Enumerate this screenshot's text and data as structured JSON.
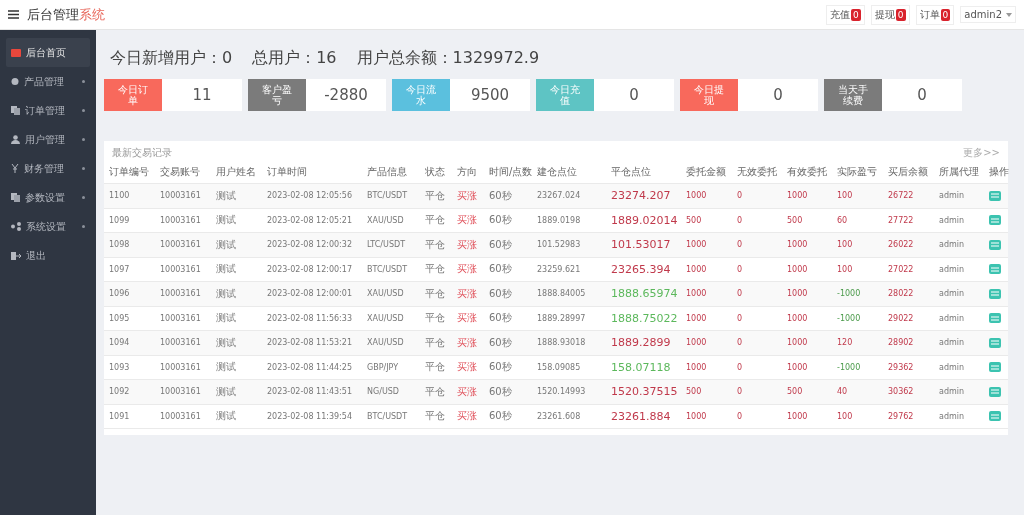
{
  "header": {
    "title": "后台管理",
    "title_suffix": "系统",
    "badges": [
      {
        "label": "充值",
        "count": "0"
      },
      {
        "label": "提现",
        "count": "0"
      },
      {
        "label": "订单",
        "count": "0"
      }
    ],
    "user": "admin2"
  },
  "sidebar": {
    "items": [
      {
        "label": "后台首页",
        "selected": true,
        "has_children": false,
        "kind": "home"
      },
      {
        "label": "产品管理",
        "selected": false,
        "has_children": true,
        "kind": "money"
      },
      {
        "label": "订单管理",
        "selected": false,
        "has_children": true,
        "kind": "copy"
      },
      {
        "label": "用户管理",
        "selected": false,
        "has_children": true,
        "kind": "user"
      },
      {
        "label": "财务管理",
        "selected": false,
        "has_children": true,
        "kind": "yen"
      },
      {
        "label": "参数设置",
        "selected": false,
        "has_children": true,
        "kind": "copy"
      },
      {
        "label": "系统设置",
        "selected": false,
        "has_children": true,
        "kind": "share"
      },
      {
        "label": "退出",
        "selected": false,
        "has_children": false,
        "kind": "exit"
      }
    ]
  },
  "summary": [
    {
      "label": "今日新增用户：",
      "value": "0"
    },
    {
      "label": "总用户：",
      "value": "16"
    },
    {
      "label": "用户总余额：",
      "value": "1329972.9"
    }
  ],
  "stats": [
    {
      "label": "今日订单",
      "value": "11",
      "color": "#f8695c"
    },
    {
      "label": "客户盈亏",
      "value": "-2880",
      "color": "#7b7b7b"
    },
    {
      "label": "今日流水",
      "value": "9500",
      "color": "#5bc0de"
    },
    {
      "label": "今日充值",
      "value": "0",
      "color": "#5ec4c4"
    },
    {
      "label": "今日提现",
      "value": "0",
      "color": "#f8695c"
    },
    {
      "label": "当天手续费",
      "value": "0",
      "color": "#7b7b7b"
    }
  ],
  "table": {
    "title": "最新交易记录",
    "more": "更多>>",
    "columns": [
      "订单编号",
      "交易账号",
      "用户姓名",
      "订单时间",
      "产品信息",
      "状态",
      "方向",
      "时间/点数",
      "建仓点位",
      "平仓点位",
      "委托金额",
      "无效委托",
      "有效委托",
      "实际盈亏",
      "买后余额",
      "所属代理",
      "操作"
    ],
    "rows": [
      {
        "cells": [
          "1100",
          "10003161",
          "测试",
          "2023-02-08 12:05:56",
          "BTC/USDT",
          "平仓",
          "买涨",
          "60秒",
          "23267.024",
          "23274.207",
          "1000",
          "0",
          "1000",
          "100",
          "26722",
          "admin"
        ],
        "loss": false
      },
      {
        "cells": [
          "1099",
          "10003161",
          "测试",
          "2023-02-08 12:05:21",
          "XAU/USD",
          "平仓",
          "买涨",
          "60秒",
          "1889.0198",
          "1889.02014",
          "500",
          "0",
          "500",
          "60",
          "27722",
          "admin"
        ],
        "loss": false
      },
      {
        "cells": [
          "1098",
          "10003161",
          "测试",
          "2023-02-08 12:00:32",
          "LTC/USDT",
          "平仓",
          "买涨",
          "60秒",
          "101.52983",
          "101.53017",
          "1000",
          "0",
          "1000",
          "100",
          "26022",
          "admin"
        ],
        "loss": false
      },
      {
        "cells": [
          "1097",
          "10003161",
          "测试",
          "2023-02-08 12:00:17",
          "BTC/USDT",
          "平仓",
          "买涨",
          "60秒",
          "23259.621",
          "23265.394",
          "1000",
          "0",
          "1000",
          "100",
          "27022",
          "admin"
        ],
        "loss": false
      },
      {
        "cells": [
          "1096",
          "10003161",
          "测试",
          "2023-02-08 12:00:01",
          "XAU/USD",
          "平仓",
          "买涨",
          "60秒",
          "1888.84005",
          "1888.65974",
          "1000",
          "0",
          "1000",
          "-1000",
          "28022",
          "admin"
        ],
        "loss": true
      },
      {
        "cells": [
          "1095",
          "10003161",
          "测试",
          "2023-02-08 11:56:33",
          "XAU/USD",
          "平仓",
          "买涨",
          "60秒",
          "1889.28997",
          "1888.75022",
          "1000",
          "0",
          "1000",
          "-1000",
          "29022",
          "admin"
        ],
        "loss": true
      },
      {
        "cells": [
          "1094",
          "10003161",
          "测试",
          "2023-02-08 11:53:21",
          "XAU/USD",
          "平仓",
          "买涨",
          "60秒",
          "1888.93018",
          "1889.2899",
          "1000",
          "0",
          "1000",
          "120",
          "28902",
          "admin"
        ],
        "loss": false
      },
      {
        "cells": [
          "1093",
          "10003161",
          "测试",
          "2023-02-08 11:44:25",
          "GBP/JPY",
          "平仓",
          "买涨",
          "60秒",
          "158.09085",
          "158.07118",
          "1000",
          "0",
          "1000",
          "-1000",
          "29362",
          "admin"
        ],
        "loss": true
      },
      {
        "cells": [
          "1092",
          "10003161",
          "测试",
          "2023-02-08 11:43:51",
          "NG/USD",
          "平仓",
          "买涨",
          "60秒",
          "1520.14993",
          "1520.37515",
          "500",
          "0",
          "500",
          "40",
          "30362",
          "admin"
        ],
        "loss": false
      },
      {
        "cells": [
          "1091",
          "10003161",
          "测试",
          "2023-02-08 11:39:54",
          "BTC/USDT",
          "平仓",
          "买涨",
          "60秒",
          "23261.608",
          "23261.884",
          "1000",
          "0",
          "1000",
          "100",
          "29762",
          "admin"
        ],
        "loss": false
      }
    ]
  }
}
